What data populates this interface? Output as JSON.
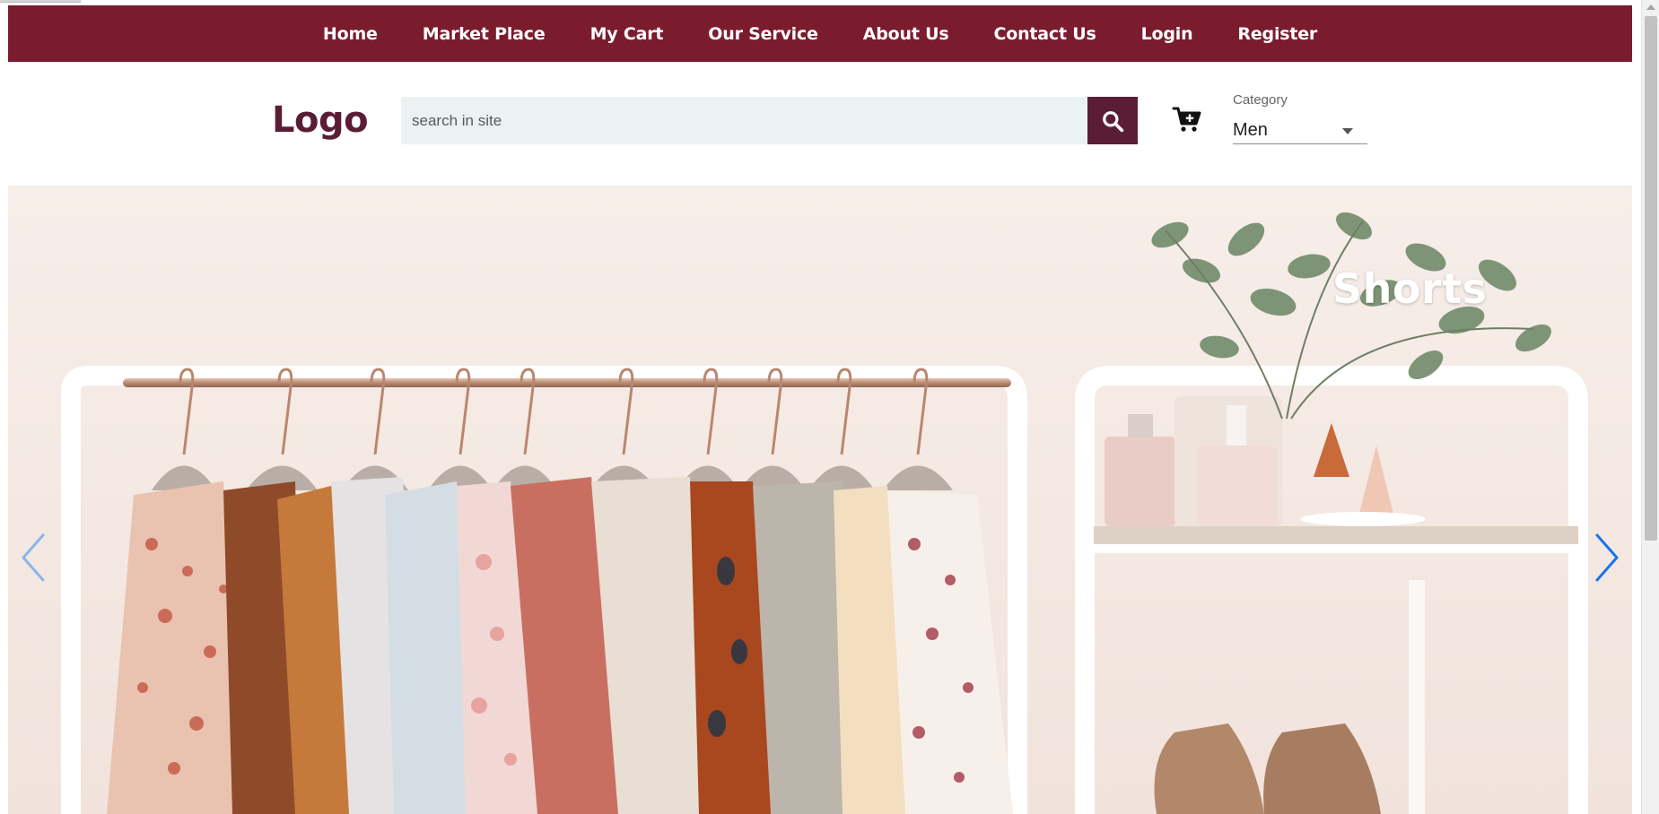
{
  "nav": {
    "items": [
      {
        "label": "Home"
      },
      {
        "label": "Market Place"
      },
      {
        "label": "My Cart"
      },
      {
        "label": "Our Service"
      },
      {
        "label": "About Us"
      },
      {
        "label": "Contact Us"
      },
      {
        "label": "Login"
      },
      {
        "label": "Register"
      }
    ]
  },
  "header": {
    "logo": "Logo",
    "search": {
      "placeholder": "search in site",
      "value": "",
      "button_icon": "search-icon"
    },
    "cart_icon": "cart-plus-icon",
    "category": {
      "label": "Category",
      "selected": "Men"
    }
  },
  "hero": {
    "slide_title": "Shorts",
    "prev_icon": "chevron-left-icon",
    "next_icon": "chevron-right-icon"
  },
  "colors": {
    "nav_bg": "#7b1c2e",
    "brand": "#5a1d35",
    "search_bg": "#eaf2f2",
    "carousel_arrow": "#1a73e8"
  }
}
